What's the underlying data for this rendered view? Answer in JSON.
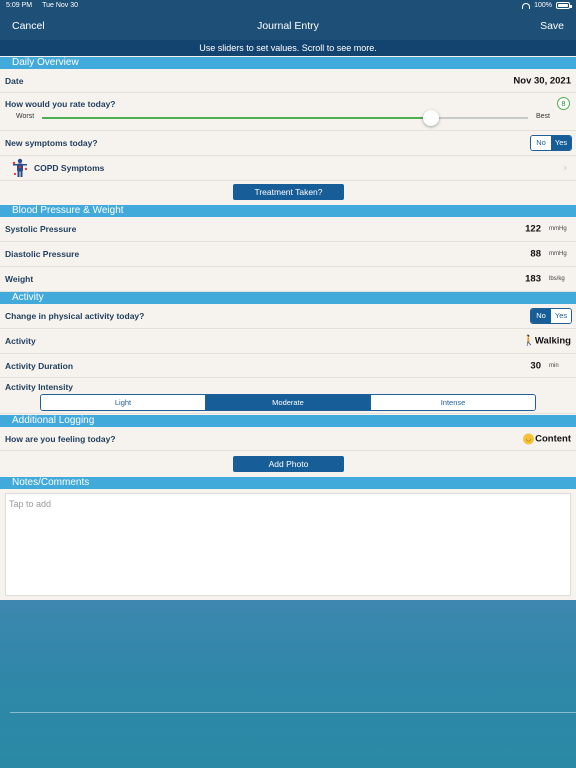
{
  "status_bar": {
    "time": "5:09 PM",
    "date": "Tue Nov 30",
    "battery": "100%"
  },
  "nav": {
    "cancel": "Cancel",
    "title": "Journal Entry",
    "save": "Save"
  },
  "hint": "Use sliders to set values. Scroll to see more.",
  "daily_overview": {
    "header": "Daily Overview",
    "date_label": "Date",
    "date_value": "Nov 30, 2021",
    "rate_label": "How would you rate today?",
    "rate_value": "8",
    "rate_fraction": 0.8,
    "slider_min_label": "Worst",
    "slider_max_label": "Best",
    "new_symptoms_label": "New symptoms today?",
    "no": "No",
    "yes": "Yes",
    "new_symptoms_selected": "Yes",
    "copd_label": "COPD Symptoms",
    "treatment_button": "Treatment Taken?"
  },
  "bp_weight": {
    "header": "Blood Pressure & Weight",
    "systolic_label": "Systolic Pressure",
    "systolic_value": "122",
    "systolic_unit": "mmHg",
    "diastolic_label": "Diastolic Pressure",
    "diastolic_value": "88",
    "diastolic_unit": "mmHg",
    "weight_label": "Weight",
    "weight_value": "183",
    "weight_unit": "lbs/kg"
  },
  "activity": {
    "header": "Activity",
    "change_label": "Change in physical activity today?",
    "no": "No",
    "yes": "Yes",
    "change_selected": "No",
    "activity_label": "Activity",
    "activity_icon": "walking-person-icon",
    "activity_value": "Walking",
    "duration_label": "Activity Duration",
    "duration_value": "30",
    "duration_unit": "min",
    "intensity_label": "Activity Intensity",
    "intensity_options": [
      "Light",
      "Moderate",
      "Intense"
    ],
    "intensity_selected": "Moderate"
  },
  "additional": {
    "header": "Additional Logging",
    "feeling_label": "How are you feeling today?",
    "feeling_icon": "smiley-icon",
    "feeling_value": "Content",
    "add_photo": "Add Photo"
  },
  "notes": {
    "header": "Notes/Comments",
    "placeholder": "Tap to add"
  },
  "colors": {
    "nav": "#1d4f77",
    "section": "#42a9db",
    "button": "#175e98",
    "slider": "#4caf50"
  }
}
